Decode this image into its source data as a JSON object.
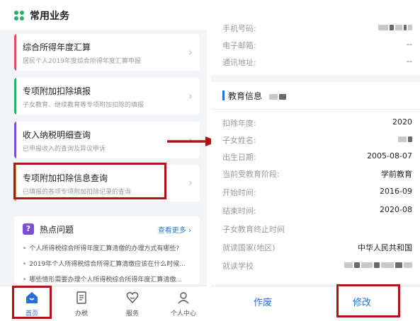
{
  "left": {
    "section_title": "常用业务",
    "cards": [
      {
        "title": "综合所得年度汇算",
        "subtitle": "居民个人2019年度综合所得年度汇算申报",
        "bar_color": "#e04a5e"
      },
      {
        "title": "专项附加扣除填报",
        "subtitle": "子女教育、继续教育等专项附加扣除的填报",
        "bar_color": "#2bb06b"
      },
      {
        "title": "收入纳税明细查询",
        "subtitle": "已申报收入的查询及异议申诉",
        "bar_color": "#7e4fd6"
      },
      {
        "title": "专项附加扣除信息查询",
        "subtitle": "已填报的各项专项附加扣除记录的查询",
        "bar_color": "#e8a23a"
      }
    ],
    "hot": {
      "icon_glyph": "?",
      "title": "热点问题",
      "more": "查看更多",
      "items": [
        "个人所得税综合所得年度汇算清缴的办理方式有哪些?",
        "2019年个人所得税综合所得汇算清缴应该在什么时候...",
        "哪些情形需要办理个人所得税综合所得年度汇算清缴..."
      ]
    },
    "tabs": [
      {
        "label": "首页",
        "icon": "home-icon"
      },
      {
        "label": "办税",
        "icon": "document-icon"
      },
      {
        "label": "服务",
        "icon": "service-icon"
      },
      {
        "label": "个人中心",
        "icon": "person-icon"
      }
    ]
  },
  "right": {
    "contact_rows": [
      {
        "label": "手机号码:",
        "value": ""
      },
      {
        "label": "电子邮箱:",
        "value": "--"
      },
      {
        "label": "通讯地址:",
        "value": "--"
      }
    ],
    "section_title": "教育信息",
    "edu_rows": [
      {
        "label": "扣除年度:",
        "value": "2020"
      },
      {
        "label": "子女姓名:",
        "value": ""
      },
      {
        "label": "出生日期:",
        "value": "2005-08-07"
      },
      {
        "label": "当前受教育阶段:",
        "value": "学前教育"
      },
      {
        "label": "开始时间:",
        "value": "2016-09"
      },
      {
        "label": "结束时间:",
        "value": "2020-08"
      },
      {
        "label": "子女教育终止时间",
        "value": ""
      },
      {
        "label": "就读国家(地区)",
        "value": "中华人民共和国"
      },
      {
        "label": "就读学校",
        "value": ""
      }
    ],
    "buttons": {
      "void": "作废",
      "edit": "修改"
    }
  },
  "colors": {
    "accent": "#2a6fd6",
    "highlight": "#b01416",
    "green": "#2bb06b",
    "purple": "#7e4fd6"
  }
}
